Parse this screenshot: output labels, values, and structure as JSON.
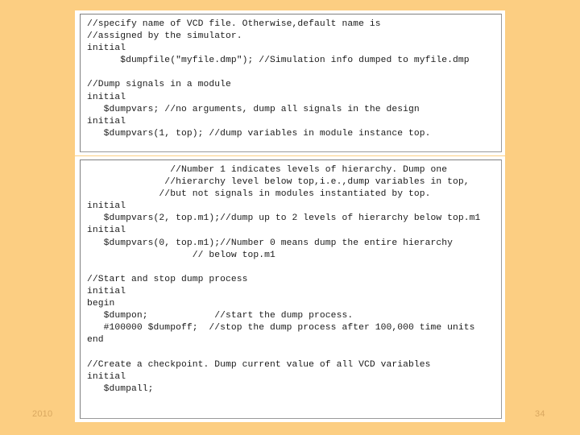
{
  "slide": {
    "background_color": "#fcce82",
    "footer": {
      "year": "2010",
      "page_number": "34"
    },
    "code_blocks": [
      {
        "name": "vcd-dumpfile-dumpvars-block",
        "lines": [
          "//specify name of VCD file. Otherwise,default name is",
          "//assigned by the simulator.",
          "initial",
          "      $dumpfile(\"myfile.dmp\"); //Simulation info dumped to myfile.dmp",
          "",
          "//Dump signals in a module",
          "initial",
          "   $dumpvars; //no arguments, dump all signals in the design",
          "initial",
          "   $dumpvars(1, top); //dump variables in module instance top."
        ]
      },
      {
        "name": "vcd-hierarchy-dumpon-dumpall-block",
        "lines": [
          "               //Number 1 indicates levels of hierarchy. Dump one",
          "              //hierarchy level below top,i.e.,dump variables in top,",
          "             //but not signals in modules instantiated by top.",
          "initial",
          "   $dumpvars(2, top.m1);//dump up to 2 levels of hierarchy below top.m1",
          "initial",
          "   $dumpvars(0, top.m1);//Number 0 means dump the entire hierarchy",
          "                   // below top.m1",
          "",
          "//Start and stop dump process",
          "initial",
          "begin",
          "   $dumpon;            //start the dump process.",
          "   #100000 $dumpoff;  //stop the dump process after 100,000 time units",
          "end",
          "",
          "//Create a checkpoint. Dump current value of all VCD variables",
          "initial",
          "   $dumpall;"
        ]
      }
    ]
  }
}
